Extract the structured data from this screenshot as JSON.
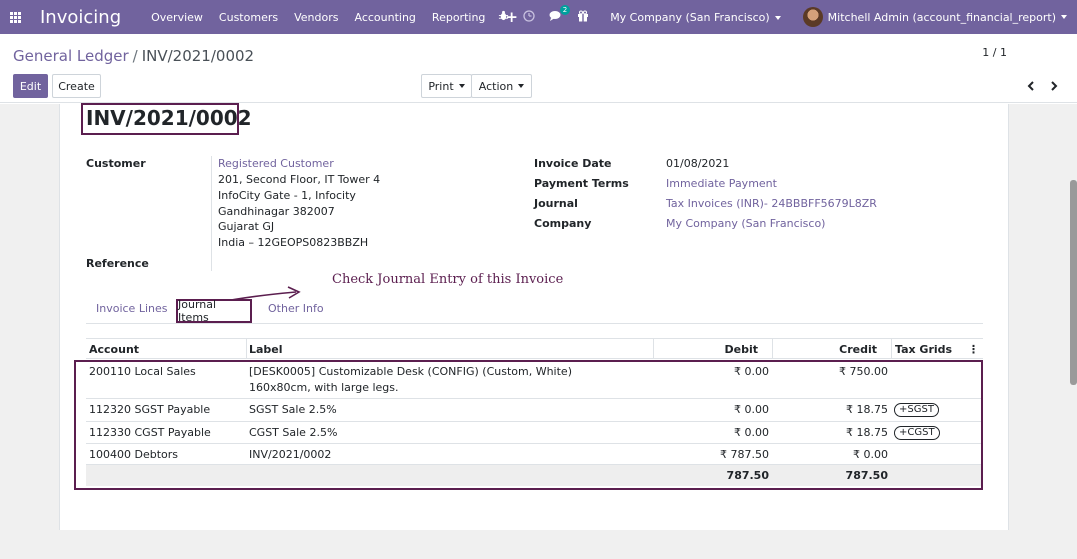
{
  "navbar": {
    "brand": "Invoicing",
    "menu": [
      "Overview",
      "Customers",
      "Vendors",
      "Accounting",
      "Reporting"
    ],
    "plus": "+",
    "chat_count": "2",
    "company": "My Company (San Francisco)",
    "user": "Mitchell Admin (account_financial_report)",
    "bg_color": "#71639e"
  },
  "control_panel": {
    "breadcrumb_parent": "General Ledger",
    "breadcrumb_sep": "/",
    "breadcrumb_current": "INV/2021/0002",
    "edit_label": "Edit",
    "create_label": "Create",
    "print_label": "Print",
    "action_label": "Action",
    "pager": "1 / 1"
  },
  "invoice": {
    "title": "INV/2021/0002",
    "customer_label": "Customer",
    "customer_name": "Registered Customer",
    "address": [
      "201, Second Floor, IT Tower 4",
      "InfoCity Gate - 1, Infocity",
      "Gandhinagar 382007",
      "Gujarat GJ",
      "India – 12GEOPS0823BBZH"
    ],
    "reference_label": "Reference",
    "invoice_date_label": "Invoice Date",
    "invoice_date": "01/08/2021",
    "payment_terms_label": "Payment Terms",
    "payment_terms": "Immediate Payment",
    "journal_label": "Journal",
    "journal": "Tax Invoices (INR)- 24BBBFF5679L8ZR",
    "company_label": "Company",
    "company": "My Company (San Francisco)"
  },
  "annotation": "Check Journal Entry of this Invoice",
  "tabs": [
    "Invoice Lines",
    "Journal Items",
    "Other Info"
  ],
  "table": {
    "headers": {
      "account": "Account",
      "label": "Label",
      "debit": "Debit",
      "credit": "Credit",
      "tax_grids": "Tax Grids"
    },
    "rows": [
      {
        "account": "200110 Local Sales",
        "label": "[DESK0005] Customizable Desk (CONFIG) (Custom, White)",
        "label2": "160x80cm, with large legs.",
        "debit": "₹ 0.00",
        "credit": "₹ 750.00",
        "tax": ""
      },
      {
        "account": "112320 SGST Payable",
        "label": "SGST Sale 2.5%",
        "label2": "",
        "debit": "₹ 0.00",
        "credit": "₹ 18.75",
        "tax": "+SGST"
      },
      {
        "account": "112330 CGST Payable",
        "label": "CGST Sale 2.5%",
        "label2": "",
        "debit": "₹ 0.00",
        "credit": "₹ 18.75",
        "tax": "+CGST"
      },
      {
        "account": "100400 Debtors",
        "label": "INV/2021/0002",
        "label2": "",
        "debit": "₹ 787.50",
        "credit": "₹ 0.00",
        "tax": ""
      }
    ],
    "total_debit": "787.50",
    "total_credit": "787.50"
  },
  "colors": {
    "accent": "#71639e",
    "annotation": "#5b1e4f"
  }
}
